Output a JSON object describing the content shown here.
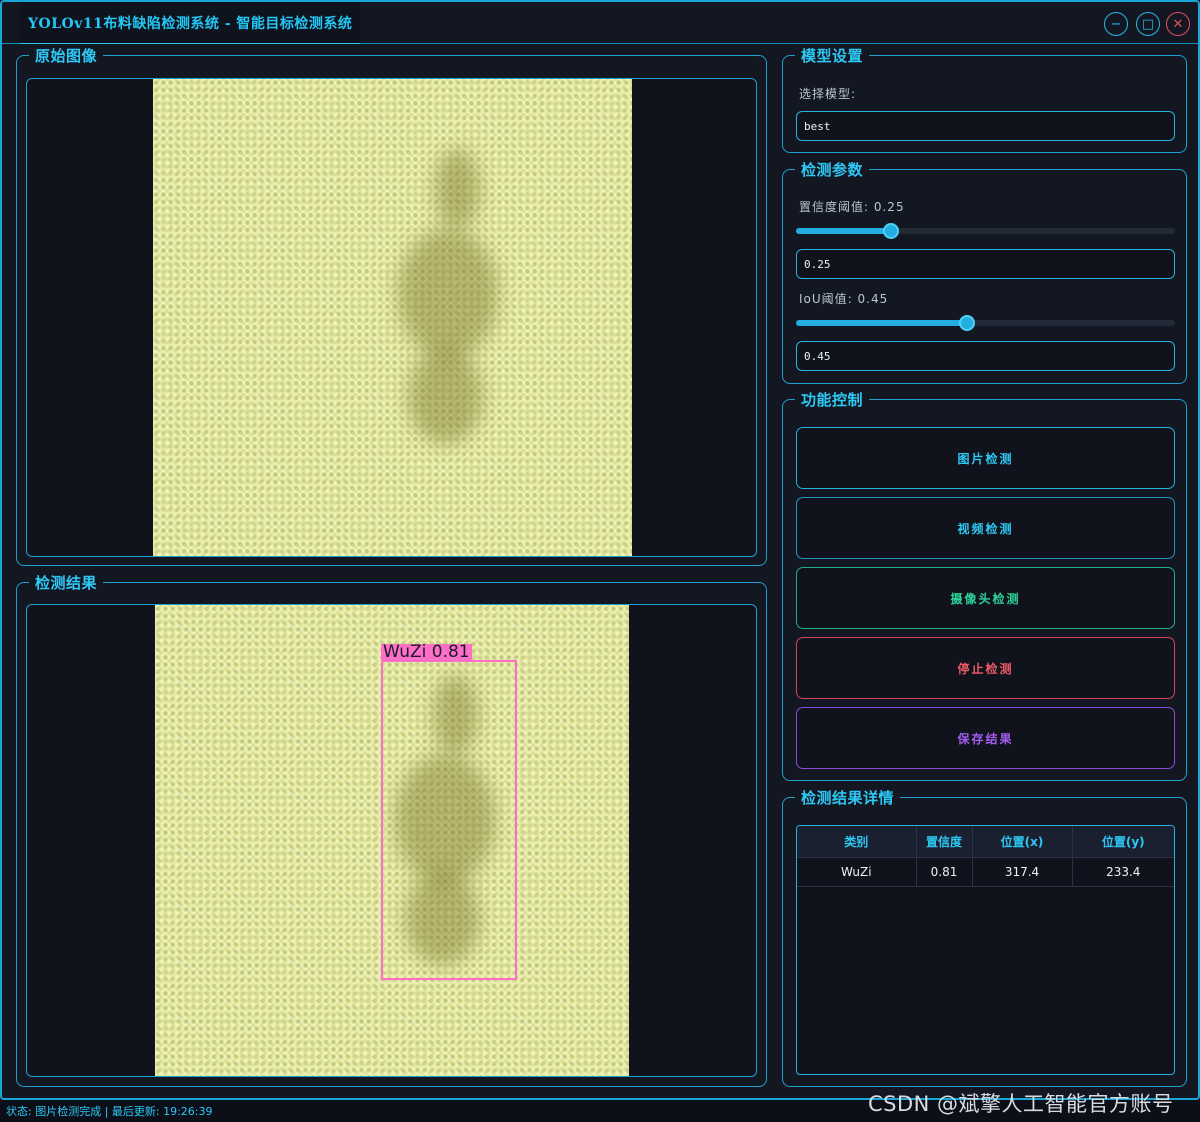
{
  "window": {
    "title": "YOLOv11布料缺陷检测系统 - 智能目标检测系统",
    "min_symbol": "−",
    "max_symbol": "□",
    "close_symbol": "✕"
  },
  "original_panel": {
    "title": "原始图像"
  },
  "result_panel": {
    "title": "检测结果",
    "detection_label": "WuZi 0.81"
  },
  "model_settings": {
    "title": "模型设置",
    "select_label": "选择模型:",
    "selected_model": "best"
  },
  "params": {
    "title": "检测参数",
    "confidence_label": "置信度阈值: 0.25",
    "confidence_value": "0.25",
    "confidence_fraction": 0.25,
    "iou_label": "IoU阈值: 0.45",
    "iou_value": "0.45",
    "iou_fraction": 0.45
  },
  "controls": {
    "title": "功能控制",
    "image_detect": "图片检测",
    "video_detect": "视频检测",
    "camera_detect": "摄像头检测",
    "stop_detect": "停止检测",
    "save_results": "保存结果"
  },
  "details": {
    "title": "检测结果详情",
    "columns": [
      "类别",
      "置信度",
      "位置(x)",
      "位置(y)"
    ],
    "rows": [
      [
        "WuZi",
        "0.81",
        "317.4",
        "233.4"
      ]
    ]
  },
  "status_bar": {
    "text": "状态: 图片检测完成 | 最后更新: 19:26:39"
  },
  "watermark": "CSDN @斌擎人工智能官方账号",
  "colors": {
    "accent": "#2ec8f5",
    "stop": "#e05060",
    "camera": "#2fd39a",
    "save": "#a35cf0",
    "detection_box": "#ff6fc8"
  }
}
